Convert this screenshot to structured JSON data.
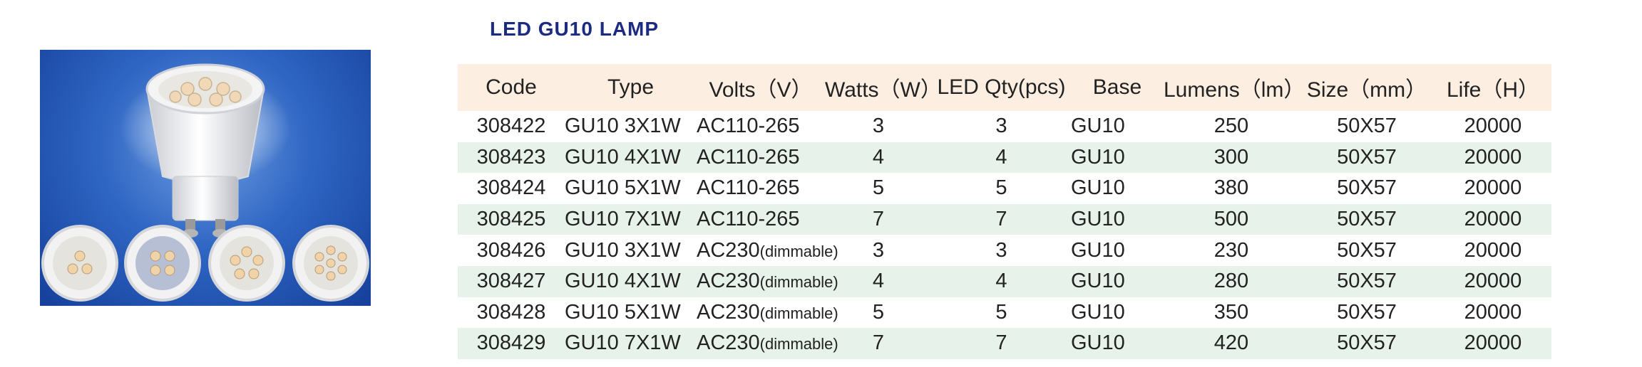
{
  "title": "LED GU10 LAMP",
  "colors": {
    "title": "#1d2a82",
    "header_bg": "#fcefe2",
    "row_alt_bg": "#e7f3ea",
    "photo_bg": "#2f66c4"
  },
  "image": {
    "icon": "led-gu10-lamp-product-photo"
  },
  "table": {
    "headers": {
      "code": "Code",
      "type": "Type",
      "volts": "Volts（V）",
      "watts": "Watts（W）",
      "led_qty": "LED Qty(pcs)",
      "base": "Base",
      "lumens": "Lumens（lm）",
      "size": "Size（mm）",
      "life": "Life（H）"
    },
    "rows": [
      {
        "code": "308422",
        "type": "GU10 3X1W",
        "volts": "AC110-265",
        "volts_note": "",
        "watts": "3",
        "led_qty": "3",
        "base": "GU10",
        "lumens": "250",
        "size": "50X57",
        "life": "20000"
      },
      {
        "code": "308423",
        "type": "GU10 4X1W",
        "volts": "AC110-265",
        "volts_note": "",
        "watts": "4",
        "led_qty": "4",
        "base": "GU10",
        "lumens": "300",
        "size": "50X57",
        "life": "20000"
      },
      {
        "code": "308424",
        "type": "GU10 5X1W",
        "volts": "AC110-265",
        "volts_note": "",
        "watts": "5",
        "led_qty": "5",
        "base": "GU10",
        "lumens": "380",
        "size": "50X57",
        "life": "20000"
      },
      {
        "code": "308425",
        "type": "GU10 7X1W",
        "volts": "AC110-265",
        "volts_note": "",
        "watts": "7",
        "led_qty": "7",
        "base": "GU10",
        "lumens": "500",
        "size": "50X57",
        "life": "20000"
      },
      {
        "code": "308426",
        "type": "GU10 3X1W",
        "volts": "AC230",
        "volts_note": "(dimmable)",
        "watts": "3",
        "led_qty": "3",
        "base": "GU10",
        "lumens": "230",
        "size": "50X57",
        "life": "20000"
      },
      {
        "code": "308427",
        "type": "GU10 4X1W",
        "volts": "AC230",
        "volts_note": "(dimmable)",
        "watts": "4",
        "led_qty": "4",
        "base": "GU10",
        "lumens": "280",
        "size": "50X57",
        "life": "20000"
      },
      {
        "code": "308428",
        "type": "GU10 5X1W",
        "volts": "AC230",
        "volts_note": "(dimmable)",
        "watts": "5",
        "led_qty": "5",
        "base": "GU10",
        "lumens": "350",
        "size": "50X57",
        "life": "20000"
      },
      {
        "code": "308429",
        "type": "GU10 7X1W",
        "volts": "AC230",
        "volts_note": "(dimmable)",
        "watts": "7",
        "led_qty": "7",
        "base": "GU10",
        "lumens": "420",
        "size": "50X57",
        "life": "20000"
      }
    ]
  }
}
